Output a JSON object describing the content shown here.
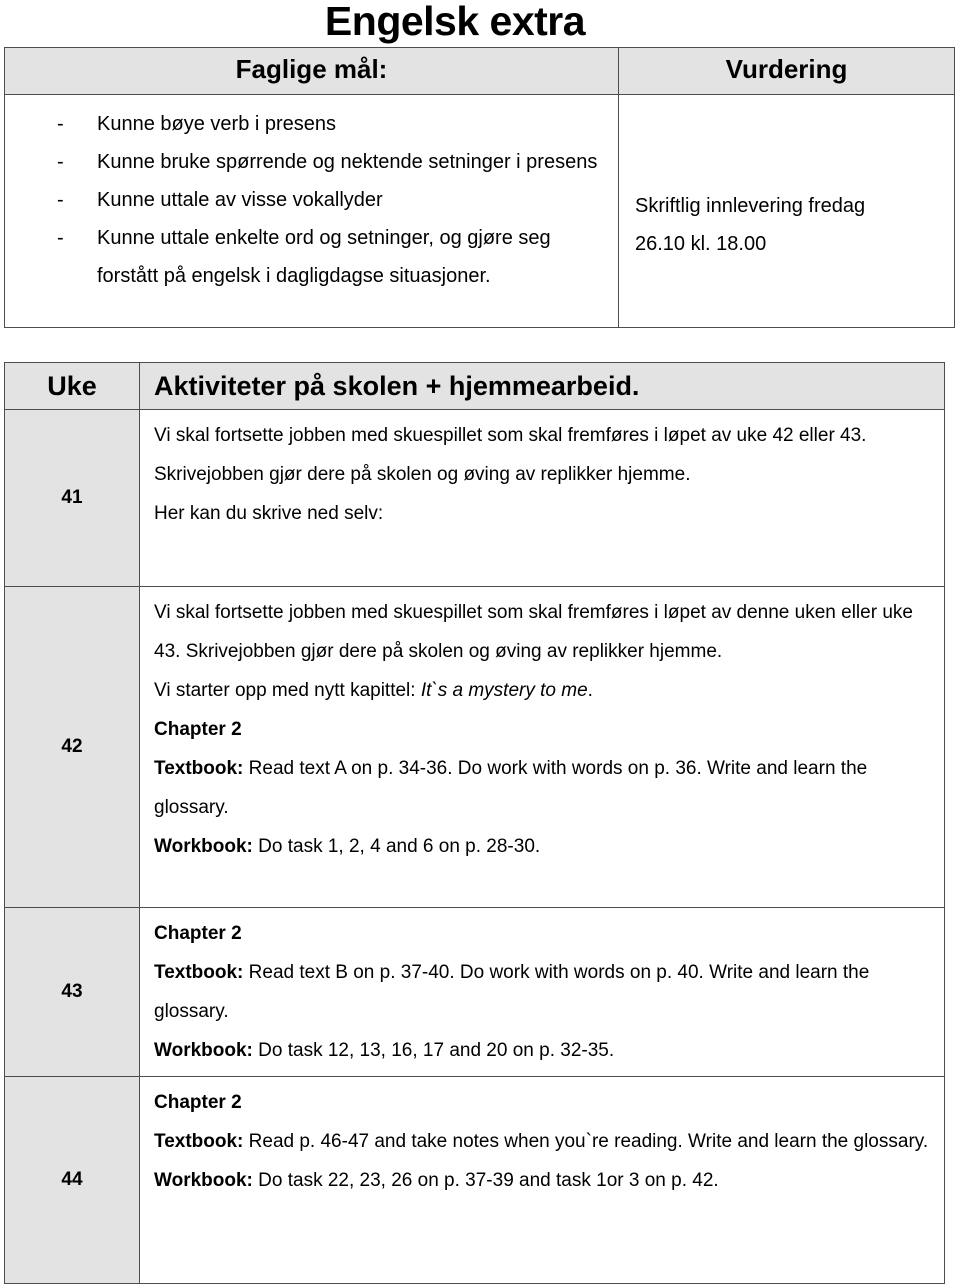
{
  "document": {
    "title": "Engelsk extra"
  },
  "goals_table": {
    "headers": {
      "goals": "Faglige mål:",
      "assessment": "Vurdering"
    },
    "bullet_marker": "-",
    "goals": [
      "Kunne bøye verb i presens",
      "Kunne bruke spørrende og nektende setninger i presens",
      "Kunne uttale av visse vokallyder",
      "Kunne uttale enkelte ord og setninger, og gjøre seg forstått på engelsk i dagligdagse situasjoner."
    ],
    "assessment_lines": [
      "Skriftlig innlevering fredag",
      "26.10 kl. 18.00"
    ]
  },
  "plan_table": {
    "headers": {
      "week": "Uke",
      "activities": "Aktiviteter på skolen + hjemmearbeid."
    },
    "rows": [
      {
        "week": "41",
        "lines": [
          {
            "text": "Vi skal fortsette jobben med skuespillet som skal fremføres i løpet av uke 42 eller 43. Skrivejobben gjør dere på skolen og øving av replikker hjemme."
          },
          {
            "text": "Her kan du skrive ned selv:"
          }
        ]
      },
      {
        "week": "42",
        "lines": [
          {
            "text": "Vi skal fortsette jobben med skuespillet som skal fremføres i løpet av denne uken eller uke 43. Skrivejobben gjør dere på skolen og øving av replikker hjemme."
          },
          {
            "prefix": "Vi starter opp med nytt kapittel: ",
            "italic": "It`s a mystery to me",
            "suffix": "."
          },
          {
            "bold": "Chapter 2"
          },
          {
            "bold": "Textbook:",
            "text": " Read text A on p. 34-36. Do work with words on p. 36. Write and learn the glossary."
          },
          {
            "bold": "Workbook:",
            "text": " Do task 1, 2, 4 and 6 on p. 28-30."
          }
        ]
      },
      {
        "week": "43",
        "lines": [
          {
            "bold": "Chapter 2"
          },
          {
            "bold": "Textbook:",
            "text": " Read text B on p. 37-40. Do work with words on p. 40. Write and learn the glossary."
          },
          {
            "bold": "Workbook:",
            "text": " Do task 12, 13, 16, 17 and 20 on p. 32-35."
          }
        ]
      },
      {
        "week": "44",
        "lines": [
          {
            "bold": "Chapter 2"
          },
          {
            "bold": "Textbook:",
            "text": " Read p. 46-47 and take notes when you`re reading. Write and learn the glossary."
          },
          {
            "bold": "Workbook:",
            "text": " Do task 22, 23, 26 on p. 37-39 and task 1or 3 on p. 42."
          }
        ]
      }
    ]
  }
}
